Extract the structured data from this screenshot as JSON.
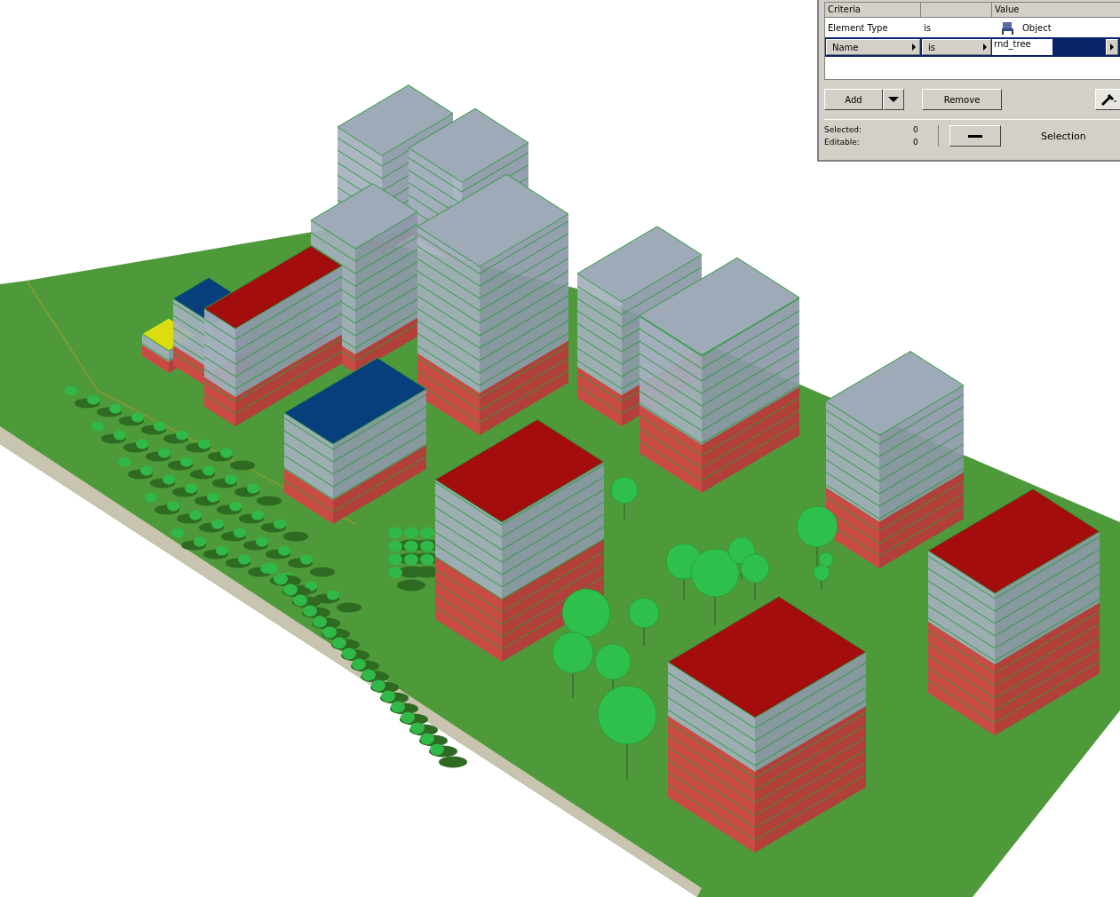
{
  "criteria_table": {
    "columns": [
      "Criteria",
      "",
      "Value"
    ],
    "rows": [
      {
        "kind": "static",
        "criterion": "Element Type",
        "operator": "is",
        "value": "Object",
        "selected": false
      },
      {
        "kind": "editable",
        "criterion": "Name",
        "operator": "is",
        "value": "rnd_tree",
        "selected": true
      }
    ]
  },
  "buttons": {
    "add": "Add",
    "remove": "Remove"
  },
  "status": {
    "selected_label": "Selected:",
    "selected_count": "0",
    "editable_label": "Editable:",
    "editable_count": "0",
    "selection_label": "Selection"
  }
}
